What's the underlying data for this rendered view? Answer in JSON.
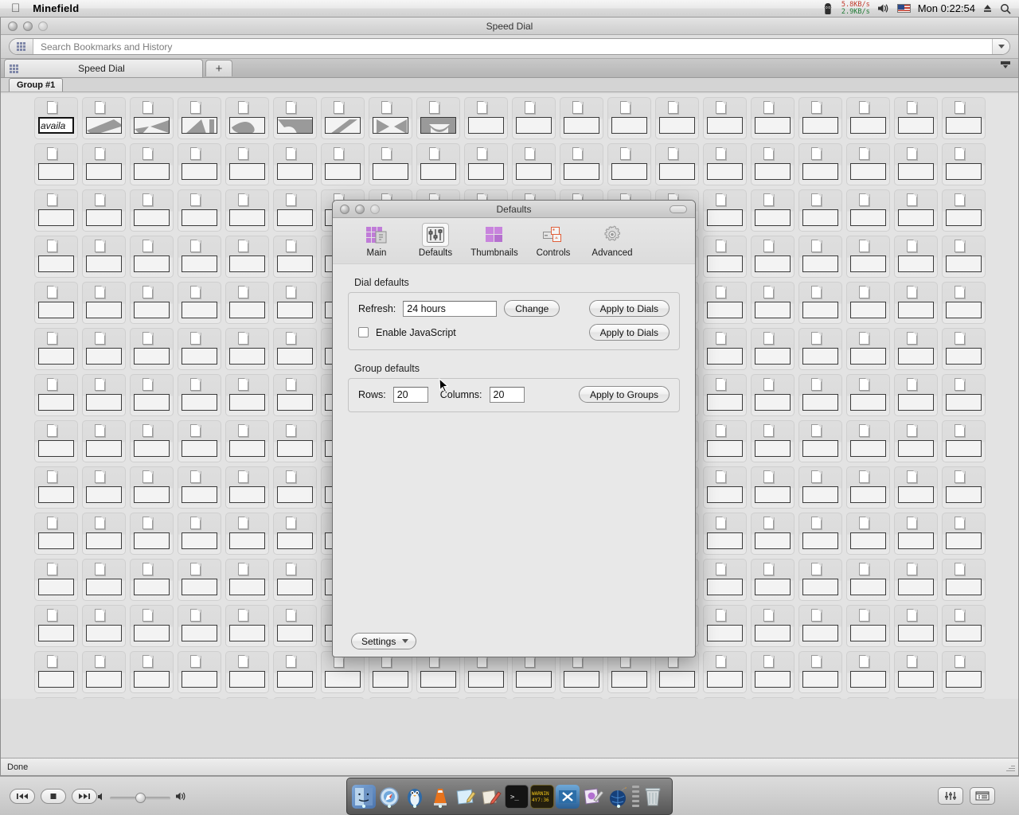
{
  "menubar": {
    "app_title": "Minefield",
    "apple_icon": "apple-logo-icon",
    "ninja_icon": "ninja-menu-icon",
    "net_up": "5.8KB/s",
    "net_down": "2.9KB/s",
    "volume_icon": "volume-icon",
    "flag_icon": "us-flag-icon",
    "clock": "Mon 0:22:54",
    "eject_icon": "eject-icon",
    "search_icon": "spotlight-search-icon"
  },
  "browser": {
    "window_title": "Speed Dial",
    "search": {
      "placeholder": "Search Bookmarks and History",
      "value": "",
      "icon": "bookmarks-grid-icon",
      "chevron": "chevron-down-icon"
    },
    "tab": {
      "label": "Speed Dial",
      "favicon": "speed-dial-grid-icon",
      "new_tab_label": "+",
      "all_tabs_icon": "list-all-tabs-icon"
    },
    "group_tab": "Group #1",
    "status": "Done"
  },
  "speed_dial": {
    "rows": 14,
    "columns": 20,
    "editing_tile_text": "availa",
    "thumb_tiles": [
      1,
      2,
      3,
      4,
      5,
      6,
      7,
      8
    ]
  },
  "dialog": {
    "title": "Defaults",
    "toolbar": [
      {
        "label": "Main",
        "icon": "main-grid-icon",
        "selected": false
      },
      {
        "label": "Defaults",
        "icon": "sliders-icon",
        "selected": true
      },
      {
        "label": "Thumbnails",
        "icon": "thumbnails-grid-icon",
        "selected": false
      },
      {
        "label": "Controls",
        "icon": "controls-windows-icon",
        "selected": false
      },
      {
        "label": "Advanced",
        "icon": "gear-icon",
        "selected": false
      }
    ],
    "dial_defaults": {
      "section_label": "Dial defaults",
      "refresh_label": "Refresh:",
      "refresh_value": "24 hours",
      "change_button": "Change",
      "apply_dials_button": "Apply to Dials",
      "javascript_label": "Enable JavaScript",
      "javascript_checked": false,
      "apply_dials_button_2": "Apply to Dials"
    },
    "group_defaults": {
      "section_label": "Group defaults",
      "rows_label": "Rows:",
      "rows_value": "20",
      "columns_label": "Columns:",
      "columns_value": "20",
      "apply_groups_button": "Apply to Groups"
    },
    "settings_button": "Settings"
  },
  "player": {
    "prev_icon": "previous-track-icon",
    "stop_icon": "stop-icon",
    "next_icon": "next-track-icon",
    "volume_low_icon": "volume-low-icon",
    "volume_high_icon": "volume-high-icon",
    "equalizer_icon": "equalizer-icon",
    "playlist_icon": "playlist-window-icon"
  },
  "dock": {
    "items": [
      {
        "name": "finder-icon",
        "glyph": "☺",
        "bg": "#5b86c4",
        "running": true
      },
      {
        "name": "safari-compass-icon",
        "glyph": "✦",
        "bg": "#3f6fa8",
        "running": true
      },
      {
        "name": "penguin-app-icon",
        "glyph": "🐧",
        "bg": "#2f6ba8",
        "running": true
      },
      {
        "name": "vlc-cone-icon",
        "glyph": "▲",
        "bg": "#e8731c",
        "running": true
      },
      {
        "name": "textedit-icon",
        "glyph": "✎",
        "bg": "#a8cfe6",
        "running": false
      },
      {
        "name": "notes-pencil-icon",
        "glyph": "✏",
        "bg": "#e3ded2",
        "running": false
      },
      {
        "name": "terminal-icon",
        "glyph": ">_",
        "bg": "#1a1a1a",
        "running": false
      },
      {
        "name": "warning-display-icon",
        "glyph": "⚠",
        "bg": "#2b2b1a",
        "running": false
      },
      {
        "name": "imovie-icon",
        "glyph": "▤",
        "bg": "#2d6ea8",
        "running": false
      },
      {
        "name": "image-editor-icon",
        "glyph": "✾",
        "bg": "#8c5fa8",
        "running": false
      },
      {
        "name": "bomb-globe-icon",
        "glyph": "✹",
        "bg": "#16407a",
        "running": true
      }
    ],
    "trash": {
      "name": "trash-icon",
      "glyph": "🗑"
    }
  },
  "colors": {
    "accent_purple": "#b26fd0",
    "accent_orange": "#e0603a",
    "net_up": "#c03a2b",
    "net_down": "#1f7a34",
    "window_bg": "#e8e8e8"
  }
}
